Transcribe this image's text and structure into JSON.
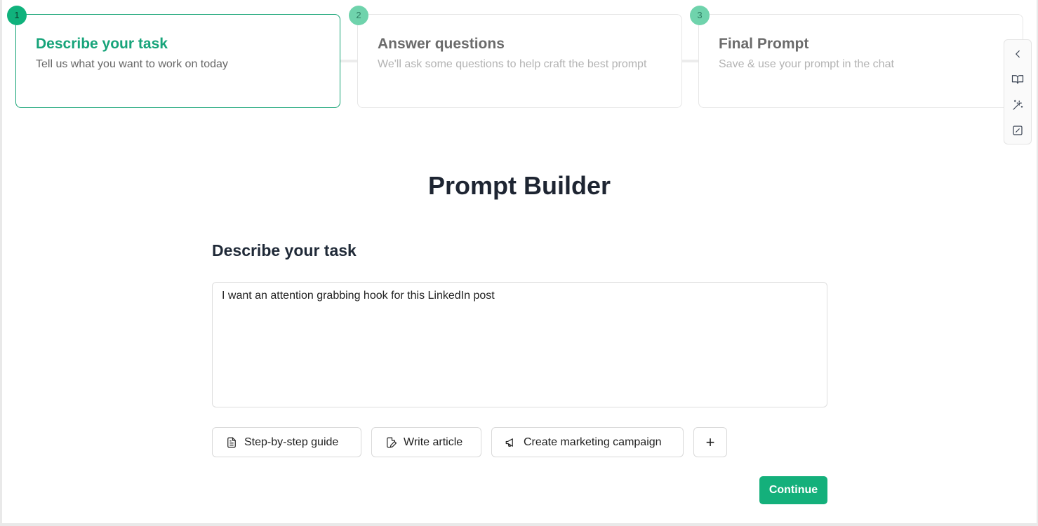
{
  "steps": [
    {
      "number": "1",
      "title": "Describe your task",
      "description": "Tell us what you want to work on today"
    },
    {
      "number": "2",
      "title": "Answer questions",
      "description": "We'll ask some questions to help craft the best prompt"
    },
    {
      "number": "3",
      "title": "Final Prompt",
      "description": "Save & use your prompt in the chat"
    }
  ],
  "side_rail": {
    "icons": [
      "chevron-left-icon",
      "book-open-icon",
      "magic-wand-icon",
      "edit-square-icon"
    ]
  },
  "page_title": "Prompt Builder",
  "task": {
    "section_title": "Describe your task",
    "value": "I want an attention grabbing hook for this LinkedIn post"
  },
  "suggestions": [
    {
      "label": "Step-by-step guide",
      "icon": "document-icon"
    },
    {
      "label": "Write article",
      "icon": "file-pen-icon"
    },
    {
      "label": "Create marketing campaign",
      "icon": "megaphone-icon"
    }
  ],
  "add_suggestion_label": "+",
  "continue_label": "Continue",
  "colors": {
    "accent": "#14b07b",
    "accent_text": "#17a47a",
    "step_badge_inactive": "#6fd3ac"
  }
}
